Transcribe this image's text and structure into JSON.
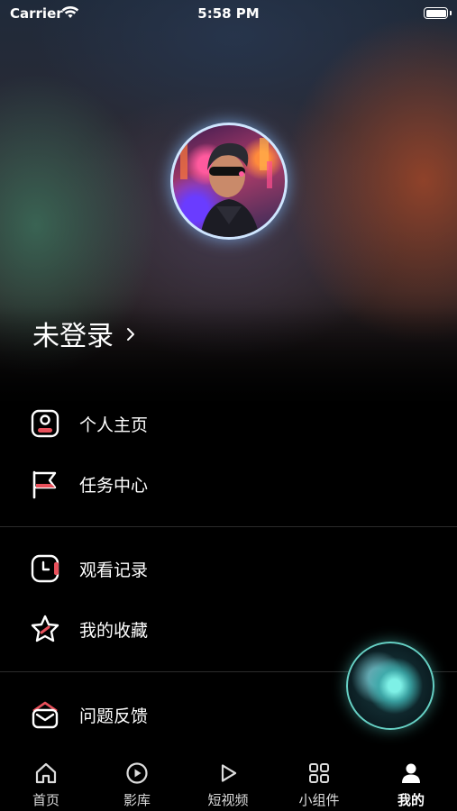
{
  "status_bar": {
    "carrier": "Carrier",
    "time": "5:58 PM"
  },
  "profile": {
    "login_label": "未登录"
  },
  "menu": {
    "items": [
      {
        "label": "个人主页",
        "icon": "profile-card-icon"
      },
      {
        "label": "任务中心",
        "icon": "flag-icon"
      },
      {
        "label": "观看记录",
        "icon": "clock-icon"
      },
      {
        "label": "我的收藏",
        "icon": "star-icon"
      },
      {
        "label": "问题反馈",
        "icon": "mail-icon"
      }
    ]
  },
  "tabbar": {
    "items": [
      {
        "label": "首页",
        "icon": "home-icon"
      },
      {
        "label": "影库",
        "icon": "play-circle-icon"
      },
      {
        "label": "短视频",
        "icon": "play-icon"
      },
      {
        "label": "小组件",
        "icon": "grid-icon"
      },
      {
        "label": "我的",
        "icon": "person-icon",
        "active": true
      }
    ]
  },
  "colors": {
    "accent": "#e8505b",
    "background": "#000000",
    "orb_border": "#66d0c4"
  }
}
